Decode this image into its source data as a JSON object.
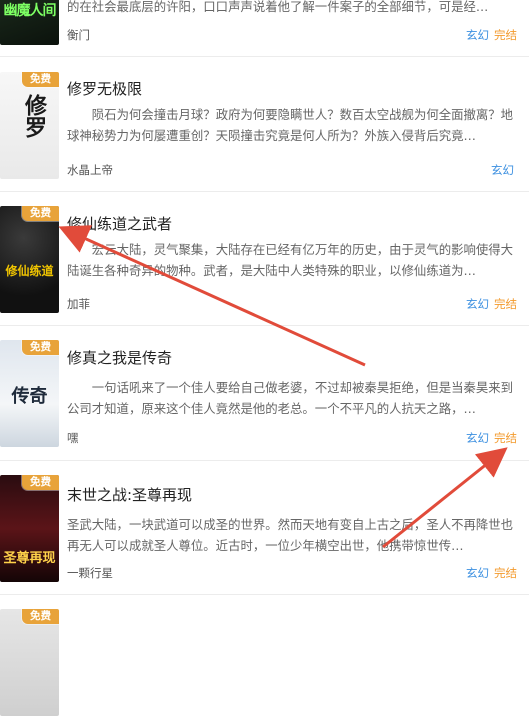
{
  "badge_label": "免费",
  "colors": {
    "genre": "#3b8fe0",
    "status": "#f39a2c",
    "badge": "#e8a33a",
    "annotation_arrow": "#e14b3a"
  },
  "books": [
    {
      "cover_text": "幽魔人间",
      "title": "",
      "desc": "的在社会最底层的许阳，口口声声说着他了解一件案子的全部细节，可是经…",
      "author": "衡门",
      "genre": "玄幻",
      "status": "完结"
    },
    {
      "cover_text": "修罗",
      "title": "修罗无极限",
      "desc": "陨石为何会撞击月球？政府为何要隐瞒世人？数百太空战舰为何全面撤离？地球神秘势力为何屡遭重创？天陨撞击究竟是何人所为？外族入侵背后究竟…",
      "author": "水晶上帝",
      "genre": "玄幻",
      "status": ""
    },
    {
      "cover_text": "修仙练道",
      "title": "修仙练道之武者",
      "desc": "宏云大陆，灵气聚集，大陆存在已经有亿万年的历史，由于灵气的影响使得大陆诞生各种奇异的物种。武者，是大陆中人类特殊的职业，以修仙练道为…",
      "author": "加菲",
      "genre": "玄幻",
      "status": "完结"
    },
    {
      "cover_text": "传奇",
      "title": "修真之我是传奇",
      "desc": "一句话吼来了一个佳人要给自己做老婆，不过却被秦昊拒绝，但是当秦昊来到公司才知道，原来这个佳人竟然是他的老总。一个不平凡的人抗天之路，…",
      "author": "嘿",
      "genre": "玄幻",
      "status": "完结"
    },
    {
      "cover_text": "圣尊再现",
      "title": "末世之战:圣尊再现",
      "desc": "圣武大陆，一块武道可以成圣的世界。然而天地有变自上古之后，圣人不再降世也再无人可以成就圣人尊位。近古时，一位少年横空出世，他携带惊世传…",
      "author": "一颗行星",
      "genre": "玄幻",
      "status": "完结"
    },
    {
      "cover_text": "",
      "title": "",
      "desc": "",
      "author": "",
      "genre": "",
      "status": ""
    }
  ]
}
